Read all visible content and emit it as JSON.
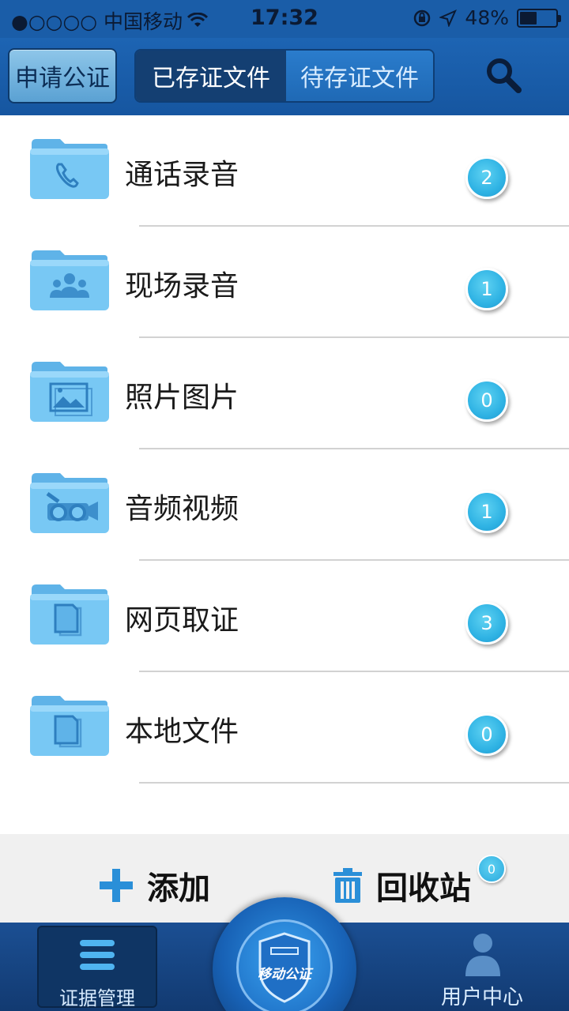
{
  "status_bar": {
    "carrier": "●○○○○ 中国移动",
    "time": "17:32",
    "battery_percent": "48%",
    "battery_level": 0.48
  },
  "nav": {
    "apply_label": "申请公证",
    "tabs": [
      {
        "label": "已存证文件",
        "active": true
      },
      {
        "label": "待存证文件",
        "active": false
      }
    ],
    "search_icon": "search-icon"
  },
  "categories": [
    {
      "label": "通话录音",
      "count": "2",
      "icon": "phone-icon"
    },
    {
      "label": "现场录音",
      "count": "1",
      "icon": "people-icon"
    },
    {
      "label": "照片图片",
      "count": "0",
      "icon": "image-icon"
    },
    {
      "label": "音频视频",
      "count": "1",
      "icon": "video-camera-icon"
    },
    {
      "label": "网页取证",
      "count": "3",
      "icon": "document-icon"
    },
    {
      "label": "本地文件",
      "count": "0",
      "icon": "document-icon"
    }
  ],
  "actions": {
    "add_label": "添加",
    "recycle_label": "回收站",
    "recycle_count": "0"
  },
  "tab_bar": {
    "evidence_label": "证据管理",
    "emblem_text": "移动公证",
    "user_label": "用户中心"
  },
  "colors": {
    "primary": "#1a5da8",
    "badge": "#2fb3e4",
    "folder": "#6fc0f0"
  }
}
